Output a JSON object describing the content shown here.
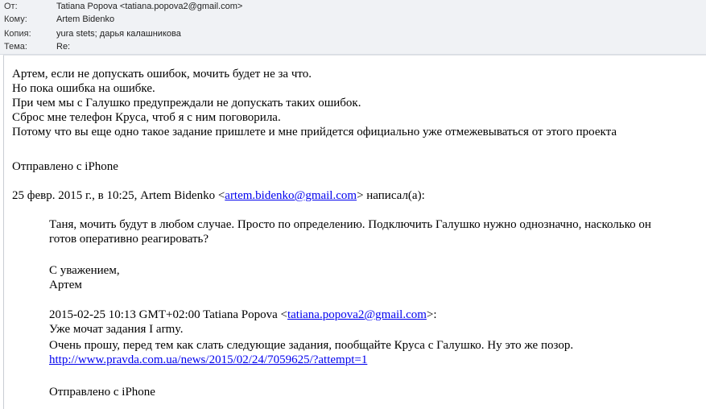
{
  "header": {
    "from_label": "От:",
    "from_value": "Tatiana Popova <tatiana.popova2@gmail.com>",
    "to_label": "Кому:",
    "to_value": "Artem Bidenko",
    "cc_label": "Копия:",
    "cc_value": "yura stets; дарья калашникова",
    "subject_label": "Тема:",
    "subject_value": "Re:"
  },
  "body": {
    "p1": "Артем, если не допускать ошибок, мочить будет не за что.",
    "p2": "Но пока ошибка на ошибке.",
    "p3": "При чем мы с Галушко предупреждали не допускать таких ошибок.",
    "p4": "Сброс мне телефон Круса, чтоб я с ним поговорила.",
    "p5": "Потому что вы еще одно такое задание пришлете и мне прийдется официально уже отмежевываться от этого проекта",
    "sig1": "Отправлено с iPhone",
    "quote_header_prefix": "25 февр. 2015 г., в 10:25, Artem Bidenko <",
    "quote_header_email": "artem.bidenko@gmail.com",
    "quote_header_suffix": "> написал(а):",
    "q1_line1": "Таня, мочить будут в любом случае. Просто по определению. Подключить Галушко нужно однозначно, насколько он",
    "q1_line2": "готов оперативно реагировать?",
    "regards": "С уважением,",
    "regards_name": "Артем",
    "q2_header_prefix": "2015-02-25 10:13 GMT+02:00 Tatiana Popova <",
    "q2_header_email": "tatiana.popova2@gmail.com",
    "q2_header_suffix": ">:",
    "q2_line1": "Уже мочат задания I army.",
    "q2_line2": "Очень прошу, перед тем как слать следующие задания, пообщайте Круса с Галушко. Ну это же позор.",
    "q2_link": "http://www.pravda.com.ua/news/2015/02/24/7059625/?attempt=1",
    "sig2": "Отправлено с iPhone"
  }
}
